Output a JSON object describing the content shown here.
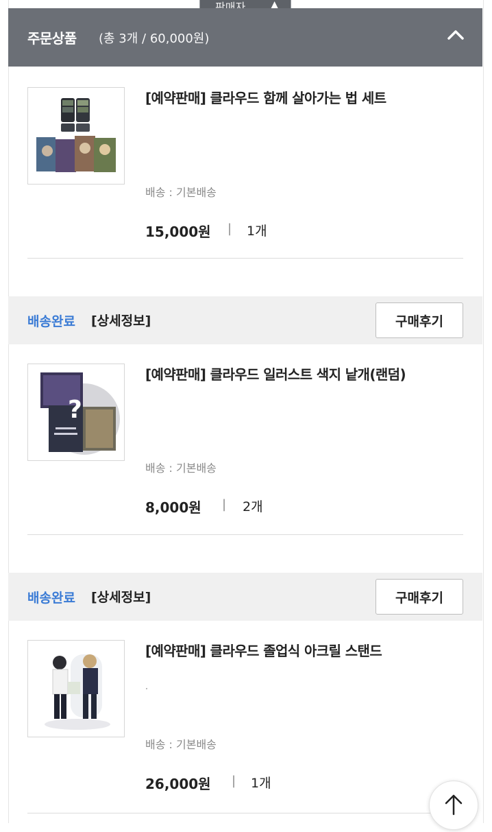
{
  "top_tip": {
    "label": "판매자"
  },
  "header": {
    "title": "주문상품",
    "summary": "(총 3개 / 60,000원)"
  },
  "items": [
    {
      "name": "[예약판매] 클라우드 함께 살아가는 법 세트",
      "shipping": "배송 : 기본배송",
      "price": "15,000원",
      "separator": "|",
      "qty": "1개"
    },
    {
      "name": "[예약판매] 클라우드 일러스트 색지 낱개(랜덤)",
      "shipping": "배송 : 기본배송",
      "price": "8,000원",
      "separator": "|",
      "qty": "2개"
    },
    {
      "name": "[예약판매] 클라우드 졸업식 아크릴 스탠드",
      "shipping": "배송 : 기본배송",
      "price": "26,000원",
      "separator": "|",
      "qty": "1개"
    }
  ],
  "status": [
    {
      "state": "배송완료",
      "detail": "[상세정보]",
      "review": "구매후기"
    },
    {
      "state": "배송완료",
      "detail": "[상세정보]",
      "review": "구매후기"
    }
  ],
  "colors": {
    "header_bg": "#6b6f76",
    "status_blue": "#3a7bd5",
    "status_bar_bg": "#f0f0f0"
  },
  "icons": {
    "collapse": "chevron-up-icon",
    "scroll_top": "arrow-up-icon"
  }
}
